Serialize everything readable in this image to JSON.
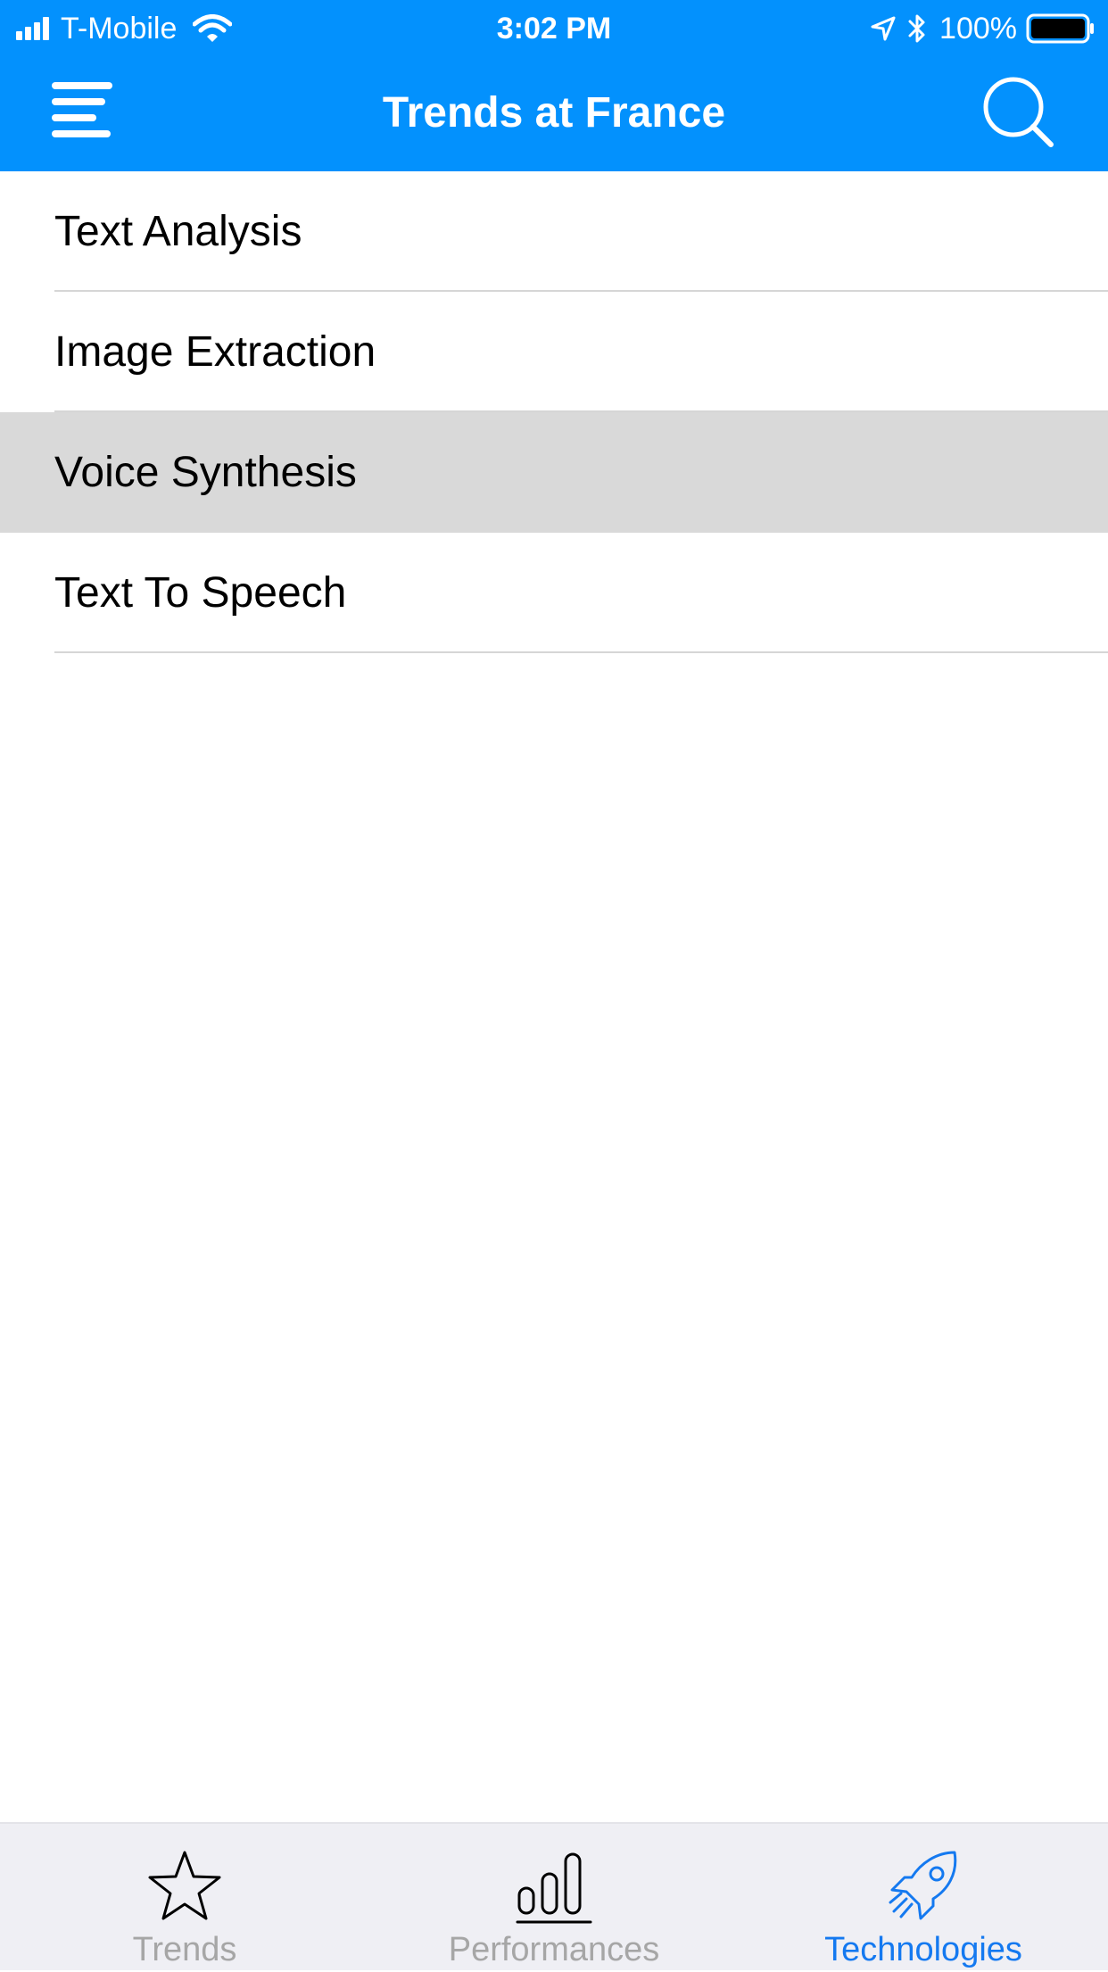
{
  "status_bar": {
    "carrier": "T-Mobile",
    "time": "3:02 PM",
    "battery_percent": "100%",
    "signal_icon": "signal-bars-icon",
    "wifi_icon": "wifi-icon",
    "location_icon": "location-arrow-icon",
    "bluetooth_icon": "bluetooth-icon",
    "battery_icon": "battery-full-icon"
  },
  "nav_bar": {
    "title": "Trends at France",
    "left_icon": "menu-icon",
    "right_icon": "search-icon"
  },
  "list": {
    "items": [
      {
        "label": "Text Analysis",
        "selected": false
      },
      {
        "label": "Image Extraction",
        "selected": false
      },
      {
        "label": "Voice Synthesis",
        "selected": true
      },
      {
        "label": "Text To Speech",
        "selected": false
      }
    ]
  },
  "tab_bar": {
    "tabs": [
      {
        "label": "Trends",
        "icon": "star-icon",
        "active": false
      },
      {
        "label": "Performances",
        "icon": "bar-chart-icon",
        "active": false
      },
      {
        "label": "Technologies",
        "icon": "rocket-icon",
        "active": true
      }
    ]
  },
  "colors": {
    "header_blue": "#0391fd",
    "selected_row": "#d9d9d9",
    "tab_active": "#1479f0",
    "tab_inactive": "#a6a6a6",
    "tab_bar_bg": "#efeff4"
  }
}
